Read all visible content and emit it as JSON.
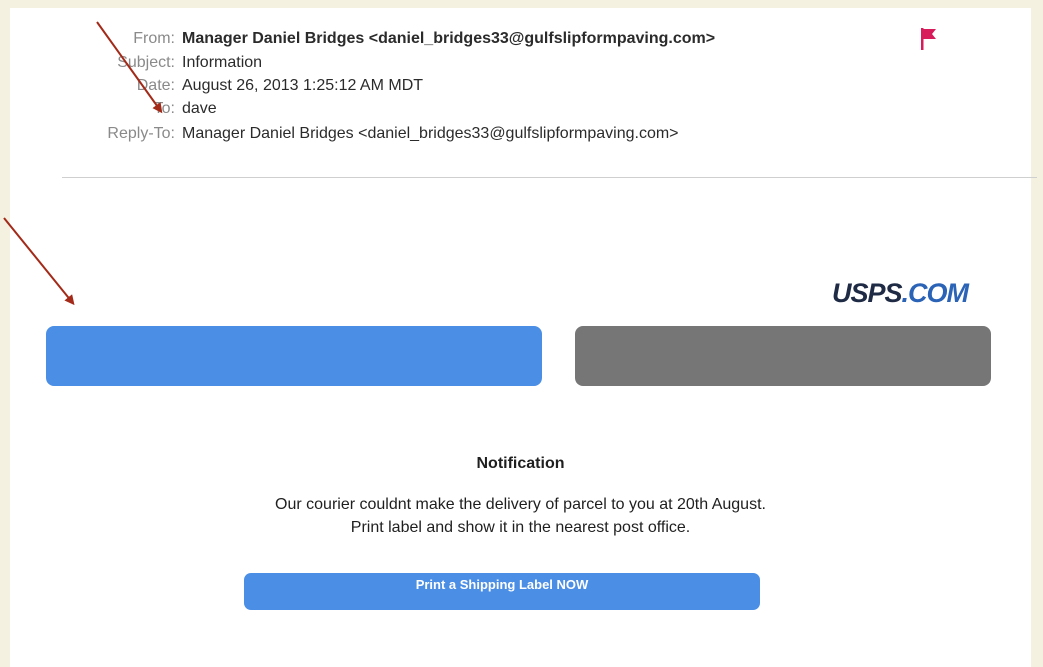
{
  "email_header": {
    "from": {
      "label": "From:",
      "value": "Manager Daniel Bridges <daniel_bridges33@gulfslipformpaving.com>"
    },
    "subject": {
      "label": "Subject:",
      "value": "Information"
    },
    "date": {
      "label": "Date:",
      "value": "August 26, 2013 1:25:12 AM MDT"
    },
    "to": {
      "label": "To:",
      "value": "dave"
    },
    "reply_to": {
      "label": "Reply-To:",
      "value": "Manager Daniel Bridges <daniel_bridges33@gulfslipformpaving.com>"
    }
  },
  "logo": {
    "part1": "USPS",
    "part2": ".COM"
  },
  "notification": {
    "title": "Notification",
    "line1": "Our courier couldnt make the delivery of parcel to you at 20th August.",
    "line2": "Print label and show it in the nearest post office."
  },
  "print_button": {
    "label": "Print a Shipping Label NOW"
  },
  "colors": {
    "flag": "#d81b5b",
    "arrow": "#a32a18",
    "button_blue": "#4a8ee6",
    "button_gray": "#767676",
    "page_border": "#f4f1e0"
  }
}
